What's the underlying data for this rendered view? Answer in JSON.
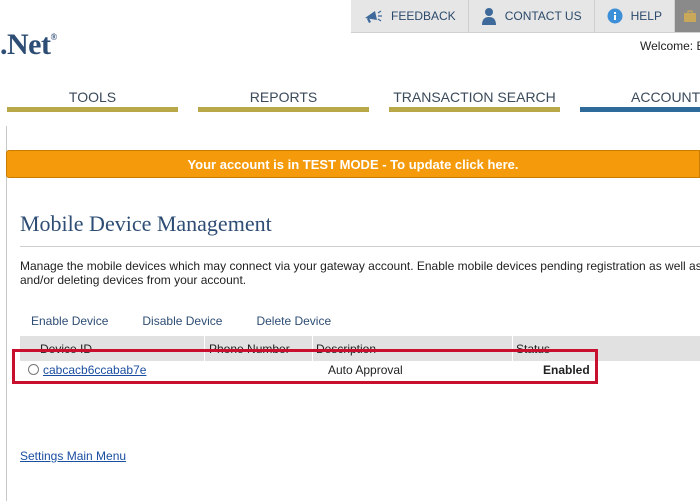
{
  "topbar": {
    "feedback": "FEEDBACK",
    "contact_us": "CONTACT US",
    "help": "HELP"
  },
  "logo": {
    "text": ".Net",
    "reg": "®"
  },
  "welcome": "Welcome: E",
  "nav": {
    "tools": "TOOLS",
    "reports": "REPORTS",
    "transaction_search": "TRANSACTION SEARCH",
    "account": "ACCOUNT"
  },
  "banner": "Your account is in TEST MODE - To update click here.",
  "page": {
    "title": "Mobile Device Management",
    "intro": "Manage the mobile devices which may connect via your gateway account. Enable mobile devices pending registration as well as and/or deleting devices from your account."
  },
  "actions": {
    "enable": "Enable Device",
    "disable": "Disable Device",
    "delete": "Delete Device"
  },
  "table": {
    "headers": [
      "Device ID",
      "Phone Number",
      "Description",
      "Status"
    ],
    "rows": [
      {
        "device_id": "cabcacb6ccabab7e",
        "phone": "",
        "description": "Auto Approval",
        "status": "Enabled"
      }
    ]
  },
  "footer": {
    "settings_link": "Settings Main Menu"
  },
  "colors": {
    "brand": "#2e4d74",
    "banner": "#f59b0b",
    "highlight": "#c8102e",
    "nav_underline": "#b8a84a",
    "nav_active": "#2f6b9a"
  }
}
